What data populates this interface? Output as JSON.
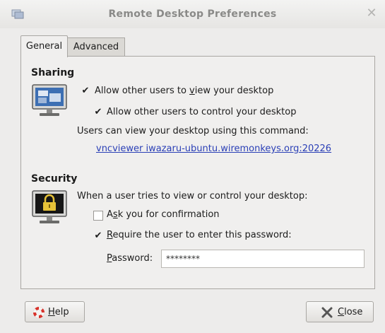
{
  "window": {
    "title": "Remote Desktop Preferences"
  },
  "tabs": [
    {
      "label": "General",
      "active": true
    },
    {
      "label": "Advanced",
      "active": false
    }
  ],
  "sharing": {
    "header": "Sharing",
    "allow_view": {
      "label_pre": "Allow other users to ",
      "mnemonic": "v",
      "label_post": "iew your desktop",
      "checked": true
    },
    "allow_control": {
      "label": "Allow other users to control your desktop",
      "checked": true
    },
    "command_text": "Users can view your desktop using this command:",
    "command_link": "vncviewer iwazaru-ubuntu.wiremonkeys.org:20226"
  },
  "security": {
    "header": "Security",
    "intro": "When a user tries to view or control your desktop:",
    "ask_confirmation": {
      "label_pre": "A",
      "mnemonic": "s",
      "label_post": "k you for confirmation",
      "checked": false
    },
    "require_password": {
      "label_pre": "",
      "mnemonic": "R",
      "label_post": "equire the user to enter this password:",
      "checked": true
    },
    "password": {
      "label_pre": "",
      "mnemonic": "P",
      "label_post": "assword:",
      "value": "********"
    }
  },
  "buttons": {
    "help": {
      "mnemonic": "H",
      "label_post": "elp"
    },
    "close": {
      "mnemonic": "C",
      "label_post": "lose"
    }
  },
  "colors": {
    "link": "#2a3fb6",
    "background": "#edeceb"
  },
  "icons": {
    "window": "remote-desktop-icon",
    "sharing": "shared-monitor-icon",
    "security": "locked-monitor-icon",
    "help": "lifebuoy-icon",
    "close": "close-x-icon"
  }
}
